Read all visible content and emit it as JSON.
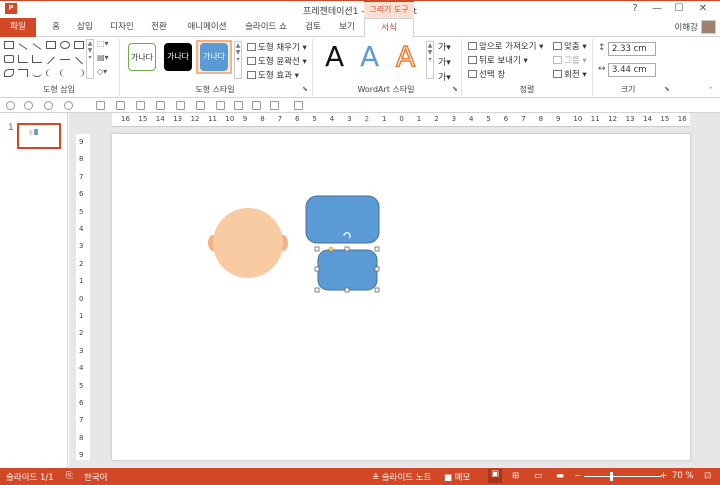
{
  "titlebar": {
    "app_icon": "P",
    "title": "프레젠테이션1 - PowerPoint",
    "context_tab": "그리기 도구",
    "help": "?",
    "min": "—",
    "max": "☐",
    "close": "✕"
  },
  "tabs": [
    "파일",
    "홈",
    "삽입",
    "디자인",
    "전환",
    "애니메이션",
    "슬라이드 쇼",
    "검토",
    "보기",
    "서식"
  ],
  "user": {
    "name": "이해강"
  },
  "ribbon": {
    "groups": [
      "도형 삽입",
      "도형 스타일",
      "WordArt 스타일",
      "정렬",
      "크기"
    ],
    "style_presets": [
      "가나다",
      "가나다",
      "가나다"
    ],
    "shape_style_cmds": [
      "도형 채우기",
      "도형 윤곽선",
      "도형 효과"
    ],
    "wordart_letters": [
      "A",
      "A",
      "A"
    ],
    "arrange_cmds": [
      "앞으로 가져오기",
      "뒤로 보내기",
      "선택 창"
    ],
    "align_cmds": [
      "맞춤",
      "그룹",
      "회전"
    ],
    "size": {
      "height": "2.33 cm",
      "width": "3.44 cm"
    }
  },
  "slide_panel": {
    "number": "1"
  },
  "hruler_labels": [
    "16",
    "15",
    "14",
    "13",
    "12",
    "11",
    "10",
    "9",
    "8",
    "7",
    "6",
    "5",
    "4",
    "3",
    "2",
    "1",
    "0",
    "1",
    "2",
    "3",
    "4",
    "5",
    "6",
    "7",
    "8",
    "9",
    "10",
    "11",
    "12",
    "13",
    "14",
    "15",
    "16"
  ],
  "vruler_labels": [
    "9",
    "8",
    "7",
    "6",
    "5",
    "4",
    "3",
    "2",
    "1",
    "0",
    "1",
    "2",
    "3",
    "4",
    "5",
    "6",
    "7",
    "8",
    "9"
  ],
  "status": {
    "slide": "슬라이드 1/1",
    "language": "한국어",
    "notes": "슬라이드 노트",
    "comments": "메모",
    "zoom": "70 %"
  },
  "colors": {
    "accent": "#d24726",
    "shape_blue": "#5b9bd5",
    "face": "#f8cba3",
    "ear": "#f4b183"
  }
}
